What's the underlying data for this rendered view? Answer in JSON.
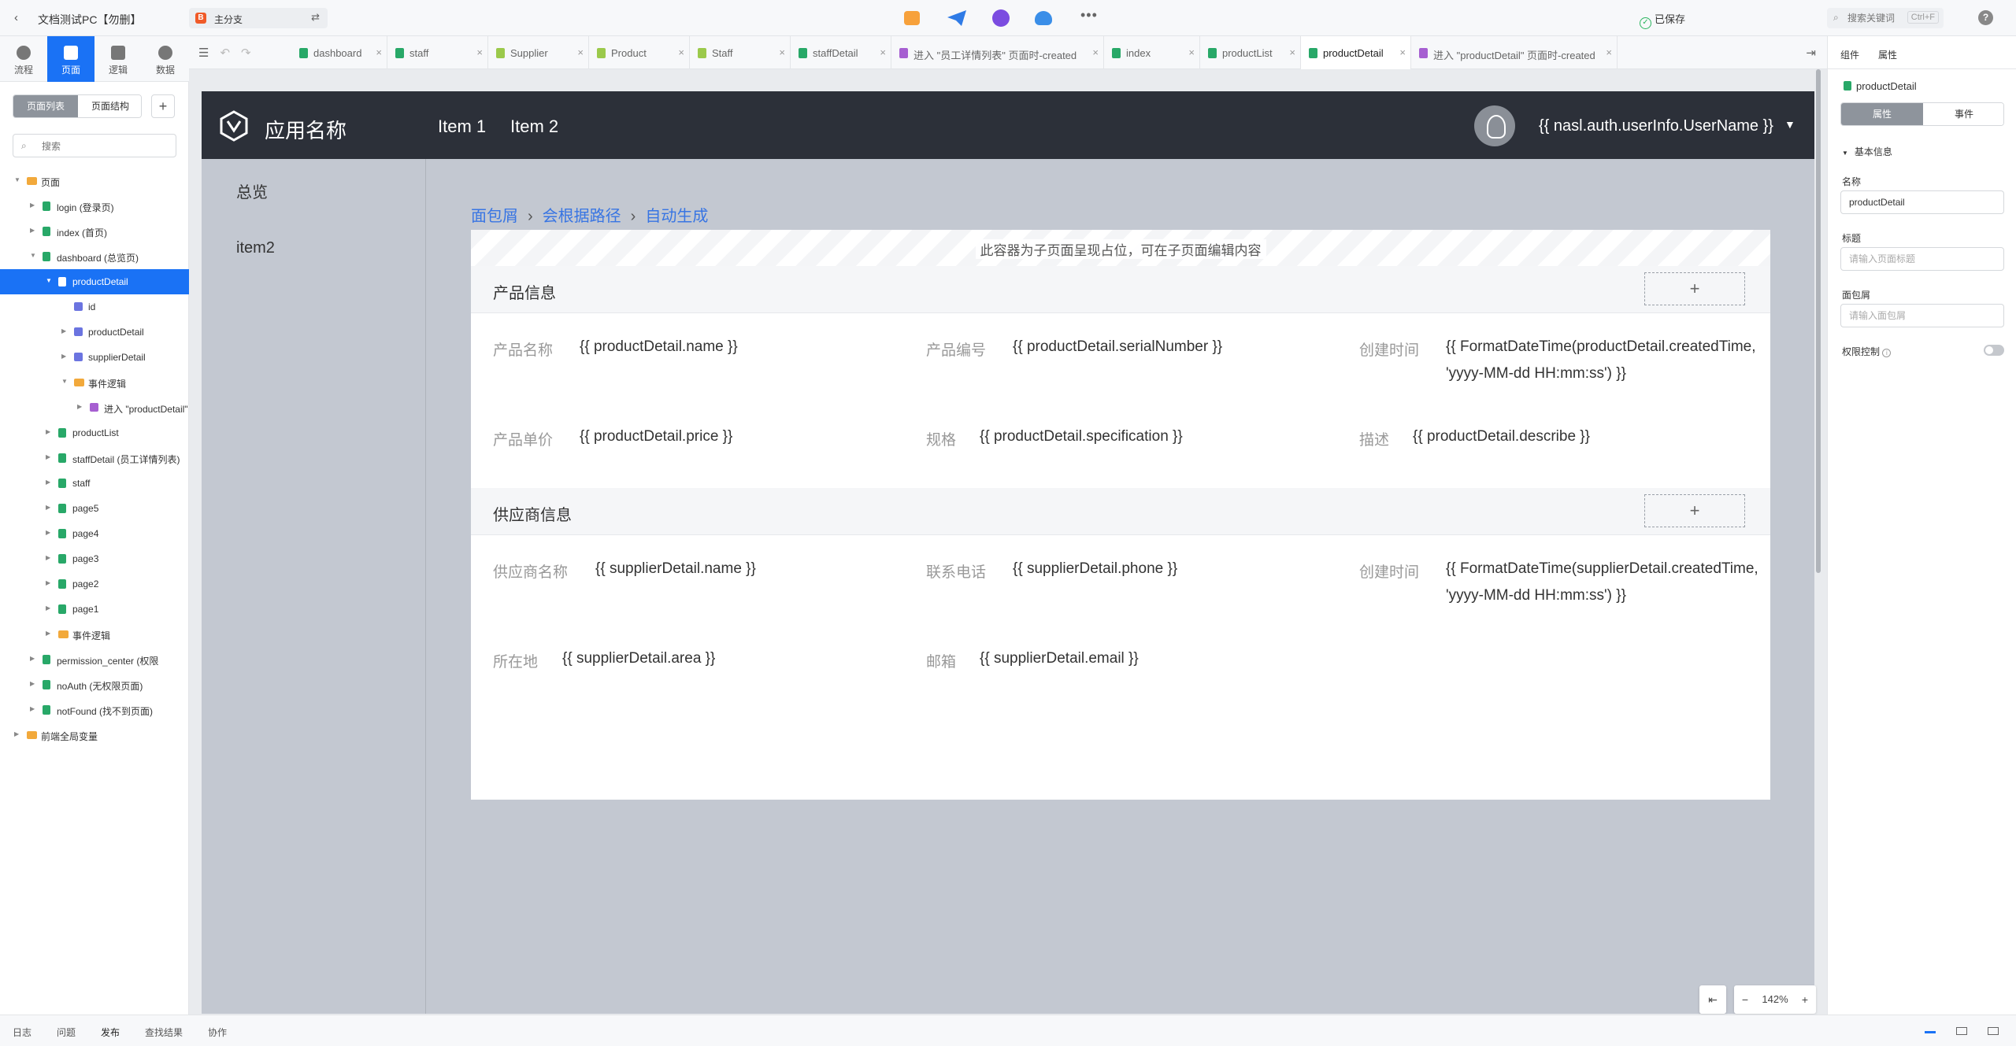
{
  "topbar": {
    "project_title": "文档测试PC【勿删】",
    "branch": {
      "icon": "B",
      "label": "主分支"
    },
    "saved": "已保存",
    "search": {
      "placeholder": "搜索关键词",
      "shortcut": "Ctrl+F"
    },
    "help": "?"
  },
  "modes": [
    {
      "label": "流程",
      "icon": "flow-icon"
    },
    {
      "label": "页面",
      "icon": "page-icon",
      "active": true
    },
    {
      "label": "逻辑",
      "icon": "logic-icon"
    },
    {
      "label": "数据",
      "icon": "data-icon"
    }
  ],
  "tabs": [
    {
      "label": "dashboard",
      "type": "page"
    },
    {
      "label": "staff",
      "type": "page"
    },
    {
      "label": "Supplier",
      "type": "entity"
    },
    {
      "label": "Product",
      "type": "entity"
    },
    {
      "label": "Staff",
      "type": "entity"
    },
    {
      "label": "staffDetail",
      "type": "page"
    },
    {
      "label": "进入 \"员工详情列表\" 页面时-created",
      "type": "logic"
    },
    {
      "label": "index",
      "type": "page"
    },
    {
      "label": "productList",
      "type": "page"
    },
    {
      "label": "productDetail",
      "type": "page",
      "active": true
    },
    {
      "label": "进入 \"productDetail\" 页面时-created",
      "type": "logic"
    }
  ],
  "sidebar": {
    "segments": [
      "页面列表",
      "页面结构"
    ],
    "add": "+",
    "search_placeholder": "搜索",
    "tree": [
      {
        "label": "页面",
        "depth": 0,
        "icon": "folder",
        "expanded": true
      },
      {
        "label": "login (登录页)",
        "depth": 1,
        "icon": "page"
      },
      {
        "label": "index (首页)",
        "depth": 1,
        "icon": "page"
      },
      {
        "label": "dashboard (总览页)",
        "depth": 1,
        "icon": "page",
        "expanded": true
      },
      {
        "label": "productDetail",
        "depth": 2,
        "icon": "page",
        "expanded": true,
        "selected": true
      },
      {
        "label": "id",
        "depth": 3,
        "icon": "var",
        "leaf": true
      },
      {
        "label": "productDetail",
        "depth": 3,
        "icon": "var"
      },
      {
        "label": "supplierDetail",
        "depth": 3,
        "icon": "var"
      },
      {
        "label": "事件逻辑",
        "depth": 3,
        "icon": "folder",
        "expanded": true
      },
      {
        "label": "进入 \"productDetail\"",
        "depth": 4,
        "icon": "logic"
      },
      {
        "label": "productList",
        "depth": 2,
        "icon": "page"
      },
      {
        "label": "staffDetail (员工详情列表)",
        "depth": 2,
        "icon": "page"
      },
      {
        "label": "staff",
        "depth": 2,
        "icon": "page"
      },
      {
        "label": "page5",
        "depth": 2,
        "icon": "page"
      },
      {
        "label": "page4",
        "depth": 2,
        "icon": "page"
      },
      {
        "label": "page3",
        "depth": 2,
        "icon": "page"
      },
      {
        "label": "page2",
        "depth": 2,
        "icon": "page"
      },
      {
        "label": "page1",
        "depth": 2,
        "icon": "page"
      },
      {
        "label": "事件逻辑",
        "depth": 2,
        "icon": "folder"
      },
      {
        "label": "permission_center (权限",
        "depth": 1,
        "icon": "page"
      },
      {
        "label": "noAuth (无权限页面)",
        "depth": 1,
        "icon": "page"
      },
      {
        "label": "notFound (找不到页面)",
        "depth": 1,
        "icon": "page"
      },
      {
        "label": "前端全局变量",
        "depth": 0,
        "icon": "folder"
      }
    ]
  },
  "app": {
    "name": "应用名称",
    "nav": [
      "Item 1",
      "Item 2"
    ],
    "user": "{{ nasl.auth.userInfo.UserName }}",
    "aside": [
      "总览",
      "item2"
    ],
    "breadcrumb": [
      "面包屑",
      "会根据路径",
      "自动生成"
    ],
    "placeholder": "此容器为子页面呈现占位，可在子页面编辑内容",
    "cards": [
      {
        "title": "产品信息",
        "add": "+",
        "rows": [
          [
            {
              "label": "产品名称",
              "value": "{{ productDetail.name }}"
            },
            {
              "label": "产品编号",
              "value": "{{ productDetail.serialNumber }}"
            },
            {
              "label": "创建时间",
              "value": "{{ FormatDateTime(productDetail.createdTime,",
              "value2": "'yyyy-MM-dd HH:mm:ss') }}"
            }
          ],
          [
            {
              "label": "产品单价",
              "value": "{{ productDetail.price }}"
            },
            {
              "label": "规格",
              "value": "{{ productDetail.specification }}"
            },
            {
              "label": "描述",
              "value": "{{ productDetail.describe }}"
            }
          ]
        ]
      },
      {
        "title": "供应商信息",
        "add": "+",
        "rows": [
          [
            {
              "label": "供应商名称",
              "value": "{{ supplierDetail.name }}"
            },
            {
              "label": "联系电话",
              "value": "{{ supplierDetail.phone }}"
            },
            {
              "label": "创建时间",
              "value": "{{ FormatDateTime(supplierDetail.createdTime,",
              "value2": "'yyyy-MM-dd HH:mm:ss') }}"
            }
          ],
          [
            {
              "label": "所在地",
              "value": "{{ supplierDetail.area }}"
            },
            {
              "label": "邮箱",
              "value": "{{ supplierDetail.email }}"
            }
          ]
        ]
      }
    ]
  },
  "zoom": {
    "collapse": "⇤",
    "minus": "−",
    "level": "142%",
    "plus": "+"
  },
  "rpanel": {
    "tabs": [
      "组件",
      "属性"
    ],
    "component": "productDetail",
    "segments": [
      "属性",
      "事件"
    ],
    "section": "基本信息",
    "name_label": "名称",
    "name_value": "productDetail",
    "title_label": "标题",
    "title_placeholder": "请输入页面标题",
    "crumb_label": "面包屑",
    "crumb_placeholder": "请输入面包屑",
    "permission_label": "权限控制"
  },
  "bottombar": [
    "日志",
    "问题",
    "发布",
    "查找结果",
    "协作"
  ],
  "colors": {
    "primary": "#1a72f5",
    "header": "#2c3039",
    "canvas": "#c3c8d1",
    "link": "#3875e3"
  }
}
